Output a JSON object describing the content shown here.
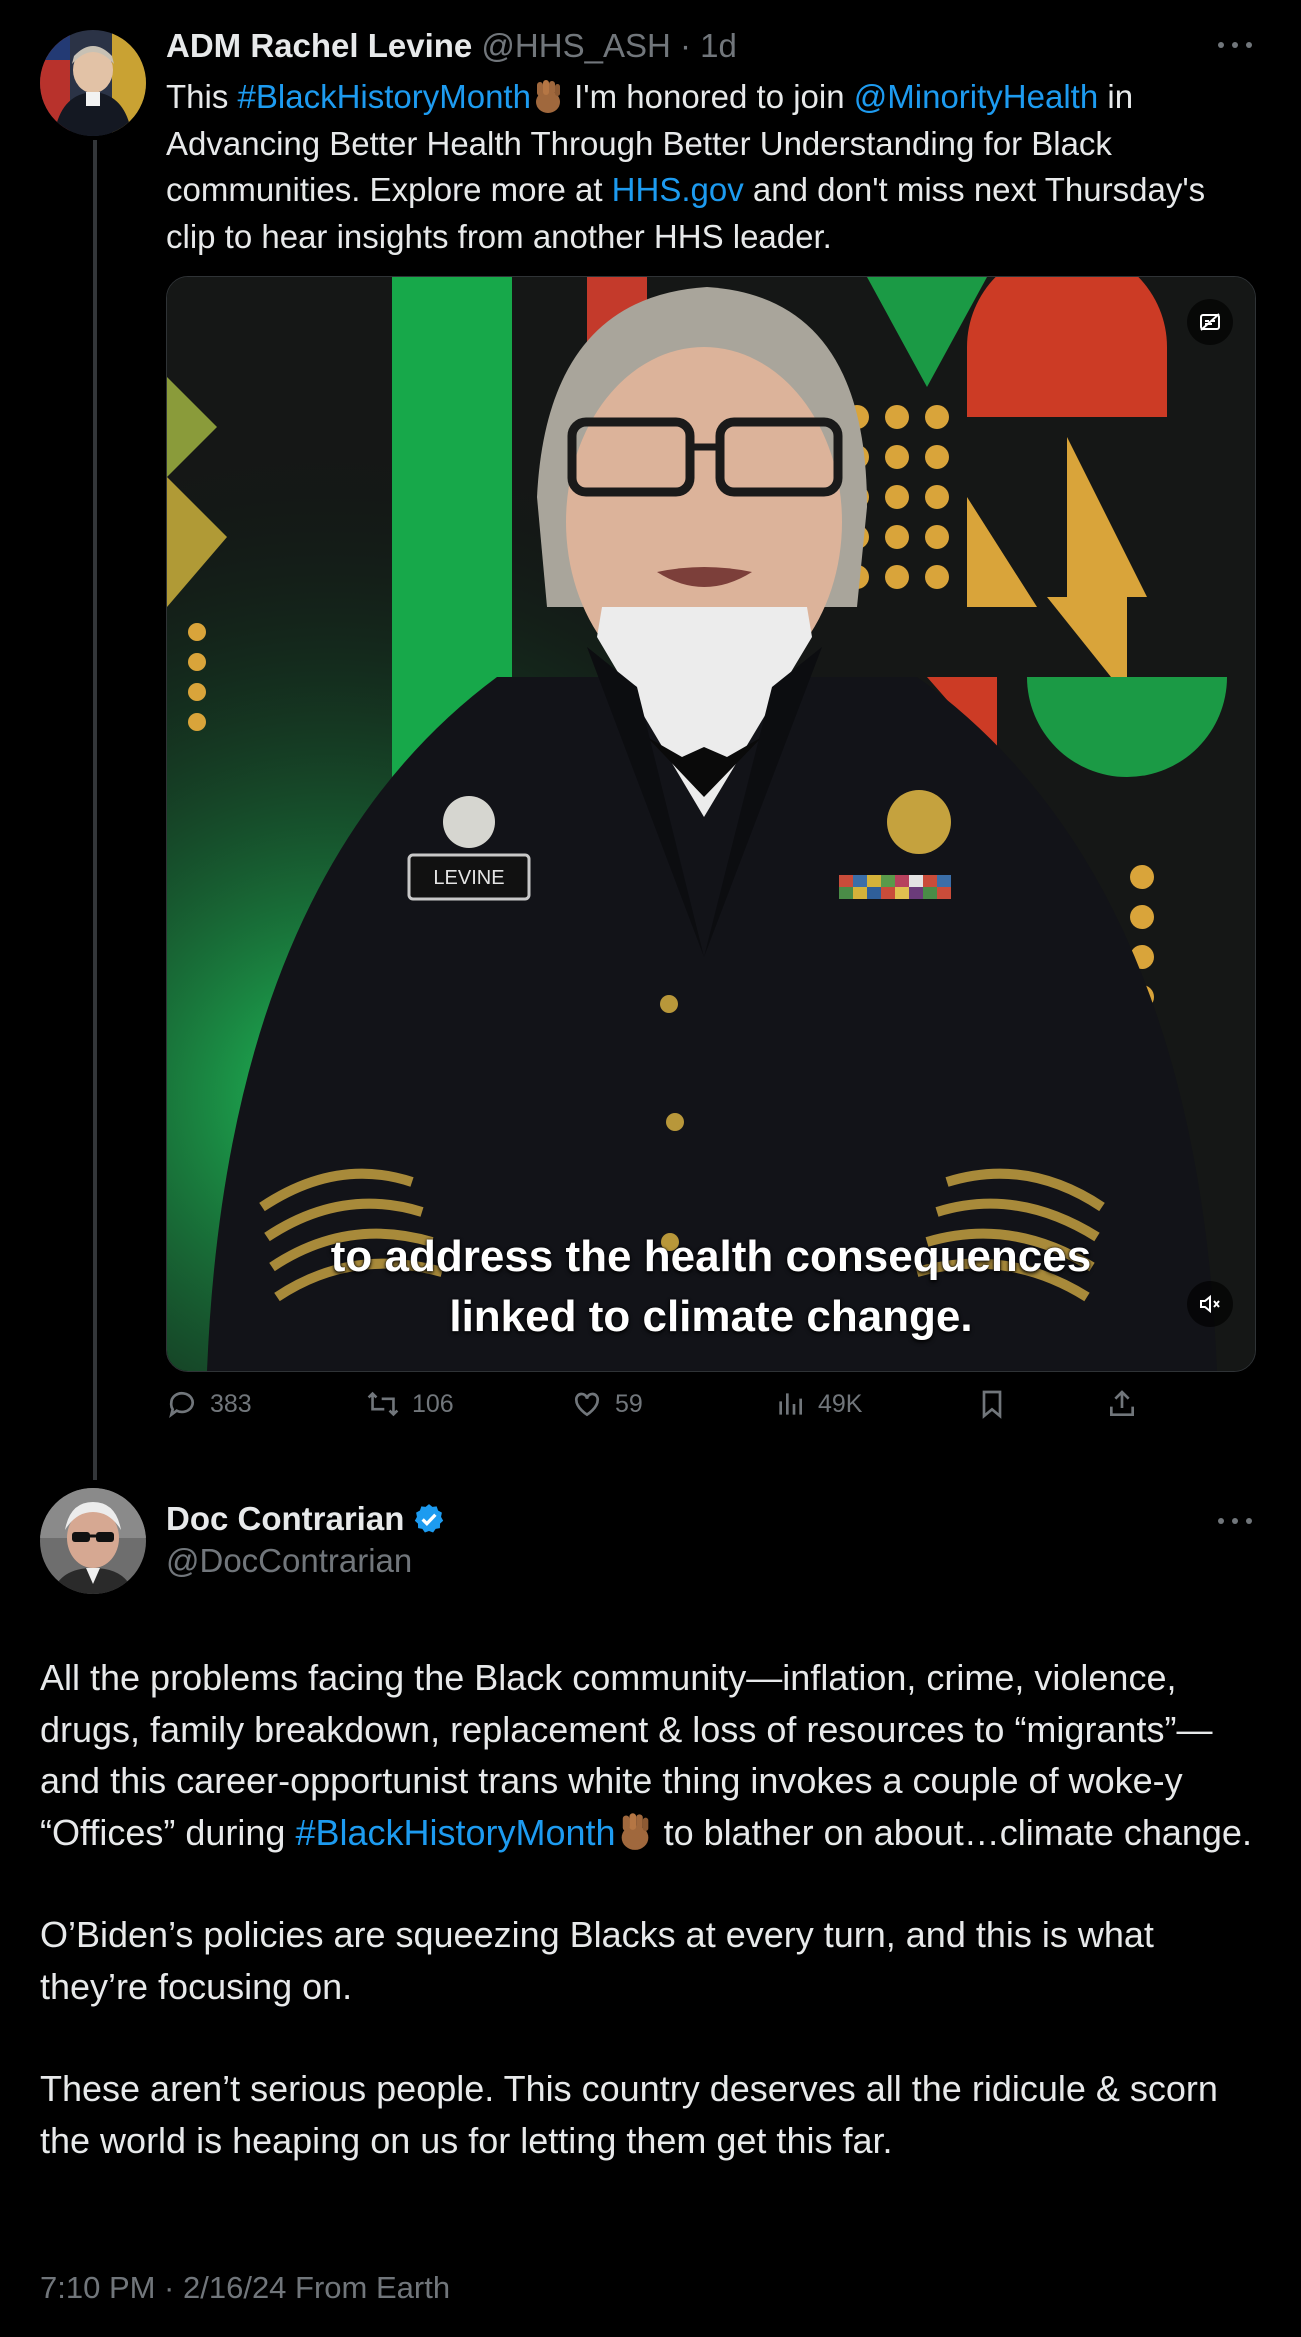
{
  "tweet1": {
    "name": "ADM Rachel Levine",
    "handle": "@HHS_ASH",
    "separator": "·",
    "time": "1d",
    "text_parts": {
      "t1": "This ",
      "hashtag": "#BlackHistoryMonth",
      "t2": " I'm honored to join ",
      "mention": "@MinorityHealth",
      "t3": " in Advancing Better Health Through Better Understanding for Black communities. Explore more at ",
      "link": "HHS.gov",
      "t4": " and don't miss next Thursday's clip to hear insights from another HHS leader."
    },
    "video": {
      "caption_line1": "to address the health consequences",
      "caption_line2": "linked to climate change.",
      "nametag": "LEVINE"
    },
    "stats": {
      "replies": "383",
      "reposts": "106",
      "likes": "59",
      "views": "49K"
    }
  },
  "tweet2": {
    "name": "Doc Contrarian",
    "handle": "@DocContrarian",
    "p1_a": "All the problems facing the Black community—inflation, crime, violence, drugs, family breakdown, replacement & loss of resources to “migrants”—and this career-opportunist trans white thing invokes a couple of woke-y “Offices” during ",
    "p1_hashtag": "#BlackHistoryMonth",
    "p1_b": " to blather on about…climate change.",
    "p2": "O’Biden’s policies are squeezing Blacks at every turn, and this is what they’re focusing on.",
    "p3": "These aren’t serious people. This country deserves all the ridicule & scorn the world is heaping on us for letting them get this far.",
    "meta": "7:10 PM · 2/16/24 From Earth"
  },
  "colors": {
    "link": "#1d9bf0",
    "muted": "#71767b",
    "text": "#e7e9ea",
    "background": "#000000",
    "verified": "#1d9bf0"
  }
}
